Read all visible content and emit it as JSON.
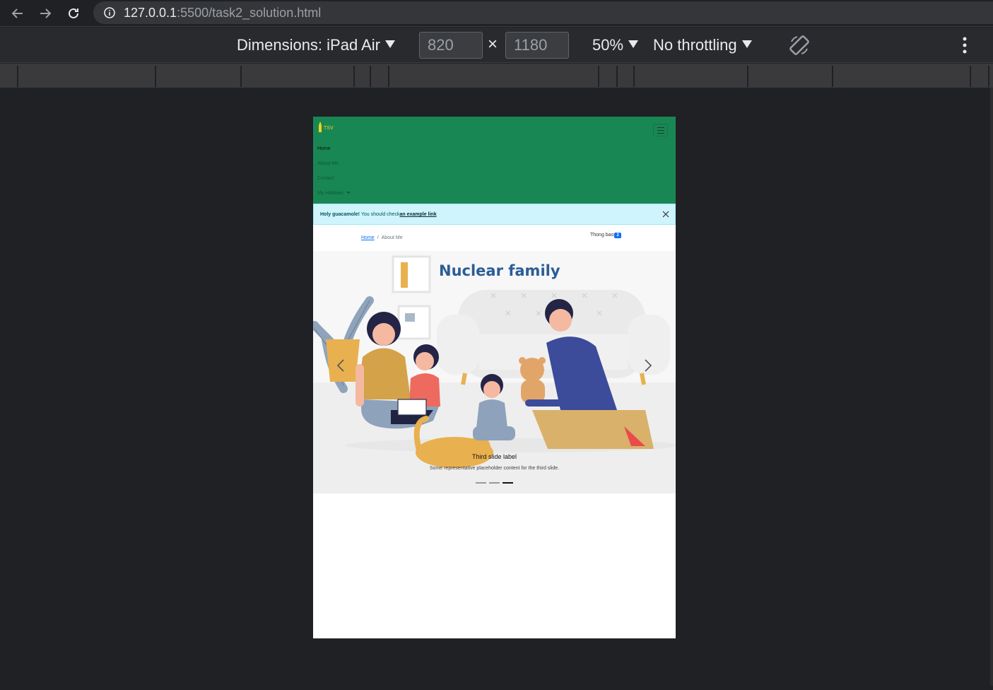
{
  "browser": {
    "url_host": "127.0.0.1",
    "url_path": ":5500/task2_solution.html"
  },
  "devtools": {
    "dimensions_label": "Dimensions: iPad Air",
    "width": "820",
    "height": "1180",
    "times": "×",
    "zoom": "50%",
    "throttling": "No throttling"
  },
  "site": {
    "brand_text": "TSV",
    "nav": {
      "items": [
        "Home",
        "About Me",
        "Contact",
        "My Hobbies"
      ]
    },
    "alert": {
      "strong": "Holy guacamole!",
      "text": " You should check",
      "link": "an example link"
    },
    "breadcrumb": {
      "home": "Home",
      "separator": "/",
      "current": "About Me"
    },
    "notification": {
      "label": "Thong bao",
      "count": "2"
    },
    "carousel": {
      "image_title": "Nuclear family",
      "caption_title": "Third slide label",
      "caption_text": "Some representative placeholder content for the third slide.",
      "active_index": 2,
      "slide_count": 3
    }
  },
  "colors": {
    "navbar": "#198754",
    "alert_bg": "#cff4fc",
    "badge": "#0d6efd",
    "image_title": "#2c5d96"
  }
}
